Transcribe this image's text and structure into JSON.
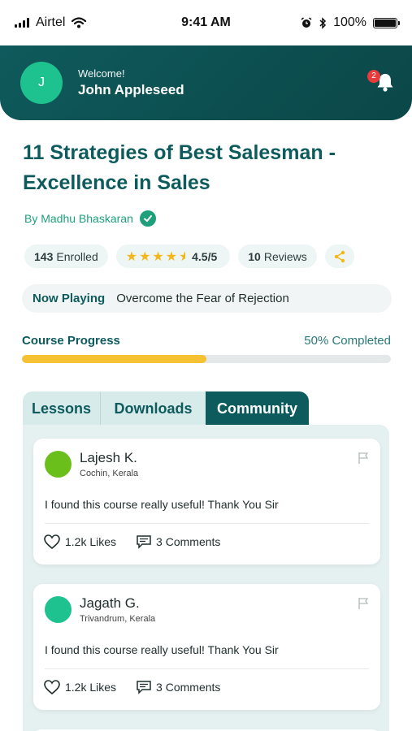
{
  "status_bar": {
    "carrier": "Airtel",
    "time": "9:41 AM",
    "battery": "100%"
  },
  "header": {
    "avatar_initial": "J",
    "welcome": "Welcome!",
    "user_name": "John Appleseed",
    "notification_count": "2"
  },
  "course": {
    "title": "11 Strategies of Best Salesman - Excellence in Sales",
    "author": "By Madhu Bhaskaran",
    "enrolled_count": "143",
    "enrolled_label": "Enrolled",
    "rating": "4.5/5",
    "rating_value": 4.5,
    "reviews_count": "10",
    "reviews_label": "Reviews"
  },
  "now_playing": {
    "label": "Now Playing",
    "title": "Overcome the Fear of Rejection"
  },
  "progress": {
    "label": "Course Progress",
    "value_text": "50% Completed",
    "fraction": 0.5
  },
  "tabs": [
    {
      "label": "Lessons",
      "active": false
    },
    {
      "label": "Downloads",
      "active": false
    },
    {
      "label": "Community",
      "active": true
    }
  ],
  "posts": [
    {
      "name": "Lajesh K.",
      "location": "Cochin, Kerala",
      "text": "I found this course really useful! Thank You Sir",
      "likes": "1.2k Likes",
      "comments": "3 Comments",
      "avatar_color": "#6bbf1a"
    },
    {
      "name": "Jagath G.",
      "location": "Trivandrum, Kerala",
      "text": "I found this course really useful! Thank You Sir",
      "likes": "1.2k Likes",
      "comments": "3 Comments",
      "avatar_color": "#1ec28f"
    }
  ],
  "colors": {
    "primary": "#0e5b5d",
    "accent_green": "#1ea07c",
    "progress": "#f6c233",
    "star": "#f3b71a",
    "badge": "#e83b3b"
  },
  "icons": [
    "signal-icon",
    "wifi-icon",
    "alarm-icon",
    "bluetooth-icon",
    "battery-icon",
    "bell-icon",
    "verified-icon",
    "star-icon",
    "share-icon",
    "flag-icon",
    "heart-icon",
    "comment-icon"
  ]
}
